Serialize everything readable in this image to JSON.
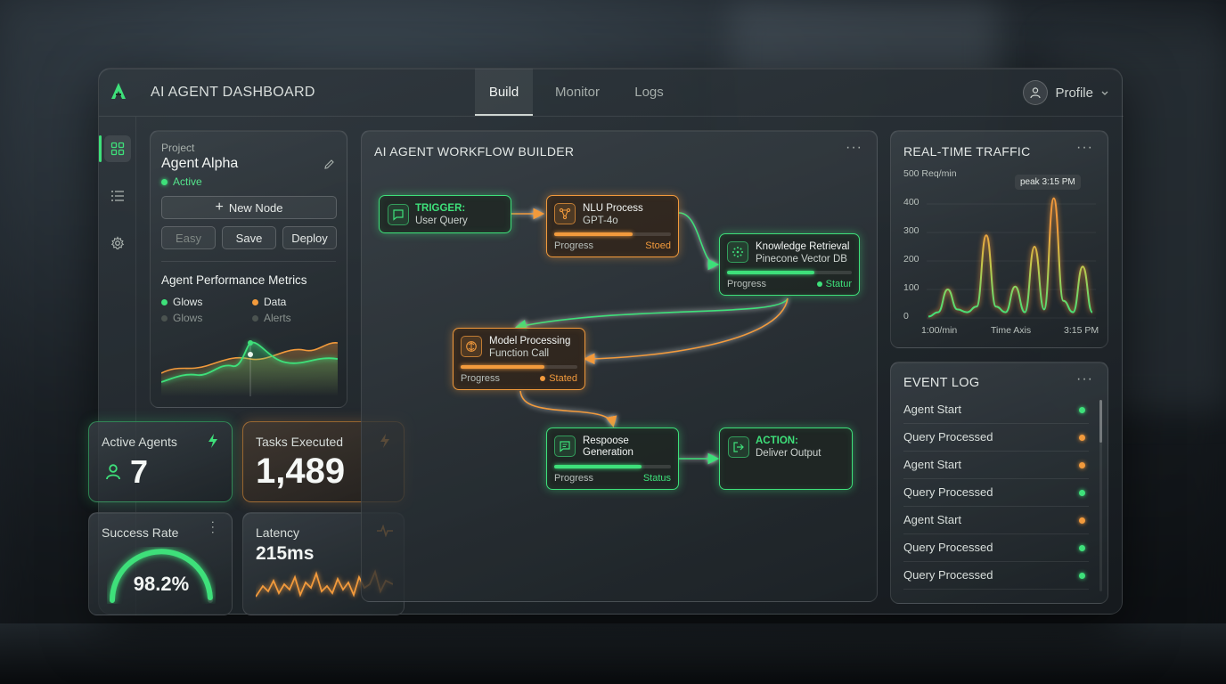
{
  "app": {
    "title": "AI AGENT DASHBOARD",
    "logo_letter": "A"
  },
  "tabs": [
    {
      "label": "Build",
      "active": true
    },
    {
      "label": "Monitor",
      "active": false
    },
    {
      "label": "Logs",
      "active": false
    }
  ],
  "profile": {
    "label": "Profile"
  },
  "sidebar": {
    "items": [
      "grid-icon",
      "list-icon",
      "gear-icon"
    ],
    "active": 0
  },
  "project": {
    "label": "Project",
    "name": "Agent Alpha",
    "status": "Active",
    "new_node_label": "New Node",
    "buttons": {
      "easy": "Easy",
      "save": "Save",
      "deploy": "Deploy"
    },
    "metrics_title": "Agent Performance Metrics",
    "legend": [
      {
        "label": "Glows",
        "color": "#3ee07a"
      },
      {
        "label": "Data",
        "color": "#f29a3c"
      },
      {
        "label": "Glows",
        "color": "#4b5350"
      },
      {
        "label": "Alerts",
        "color": "#4b5350"
      }
    ]
  },
  "stats": {
    "active_agents": {
      "label": "Active Agents",
      "value": "7"
    },
    "tasks_executed": {
      "label": "Tasks Executed",
      "value": "1,489"
    },
    "success_rate": {
      "label": "Success Rate",
      "value": "98.2%",
      "fraction": 0.982
    },
    "latency": {
      "label": "Latency",
      "value": "215ms"
    }
  },
  "workflow": {
    "title": "AI AGENT WORKFLOW BUILDER",
    "nodes": {
      "trigger": {
        "title": "TRIGGER:",
        "subtitle": "User Query"
      },
      "nlu": {
        "title": "NLU Process",
        "subtitle": "GPT-4o",
        "progress_label": "Progress",
        "status": "Stoed",
        "progress": 0.6
      },
      "knowledge": {
        "title": "Knowledge Retrieval",
        "subtitle": "Pinecone Vector DB",
        "progress_label": "Progress",
        "status": "Statur",
        "progress": 0.72
      },
      "model": {
        "title": "Model Processing",
        "subtitle": "Function Call",
        "progress_label": "Progress",
        "status": "Stated",
        "progress": 0.72
      },
      "response": {
        "title": "Respoose",
        "title2": "Generation",
        "progress_label": "Progress",
        "status": "Status",
        "progress": 0.75
      },
      "action": {
        "title": "ACTION:",
        "subtitle": "Deliver Output"
      }
    }
  },
  "traffic": {
    "title": "REAL-TIME TRAFFIC",
    "peak_label": "peak 3:15 PM",
    "chart_data": {
      "type": "line",
      "title": "REAL-TIME TRAFFIC",
      "ylabel": "500 Req/min",
      "xlabel": "Time Axis",
      "x_tick_labels": [
        "1:00/min",
        "3:15 PM"
      ],
      "y_ticks": [
        0,
        100,
        200,
        300,
        400
      ],
      "ylim": [
        0,
        500
      ],
      "series": [
        {
          "values": [
            5,
            20,
            100,
            30,
            20,
            40,
            290,
            40,
            20,
            110,
            20,
            250,
            30,
            420,
            60,
            20,
            180,
            20
          ]
        }
      ],
      "annotations": [
        "peak 3:15 PM"
      ]
    }
  },
  "event_log": {
    "title": "EVENT LOG",
    "rows": [
      {
        "label": "Agent Start",
        "color": "#3ee07a"
      },
      {
        "label": "Query Processed",
        "color": "#f29a3c"
      },
      {
        "label": "Agent Start",
        "color": "#f29a3c"
      },
      {
        "label": "Query Processed",
        "color": "#3ee07a"
      },
      {
        "label": "Agent Start",
        "color": "#f29a3c"
      },
      {
        "label": "Query Processed",
        "color": "#3ee07a"
      },
      {
        "label": "Query Processed",
        "color": "#3ee07a"
      }
    ]
  },
  "colors": {
    "green": "#3ee07a",
    "orange": "#f29a3c"
  }
}
